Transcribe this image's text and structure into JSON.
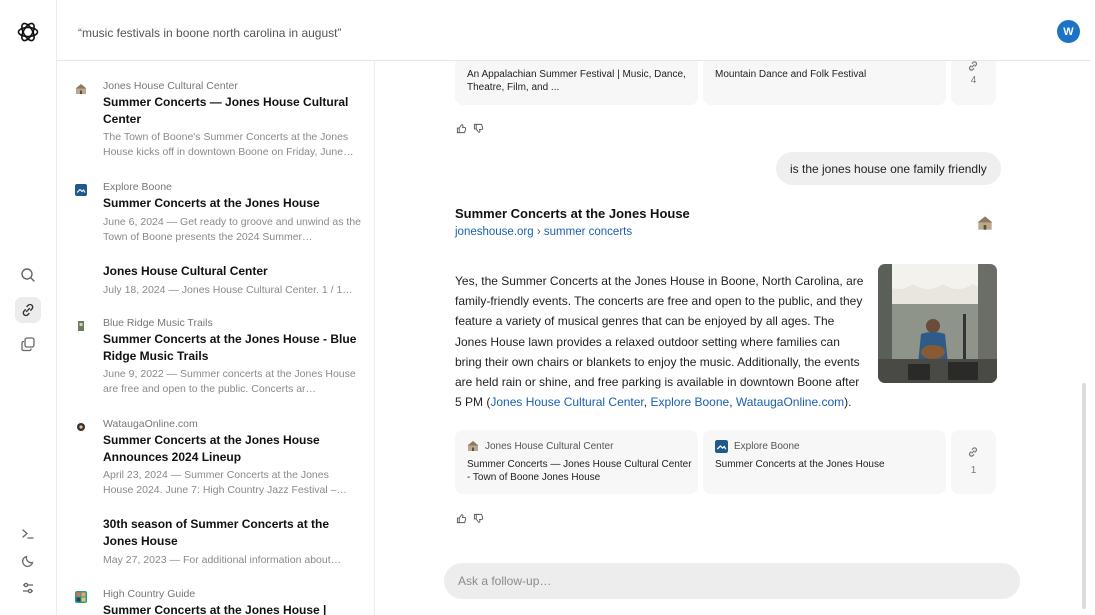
{
  "search": {
    "query": "“music festivals in boone north carolina in august”"
  },
  "user": {
    "avatar_letter": "W"
  },
  "colors": {
    "accent": "#1a73c7",
    "link": "#1a5fb4"
  },
  "rail": {
    "icons": [
      "openai-logo",
      "search-icon",
      "link-icon",
      "images-icon",
      "terminal-icon",
      "moon-icon",
      "sliders-icon"
    ]
  },
  "results": [
    {
      "source": "Jones House Cultural Center",
      "title": "Summer Concerts — Jones House Cultural Center",
      "snippet": "The Town of Boone's Summer Concerts at the Jones House kicks off in downtown Boone on Friday, June…"
    },
    {
      "source": "Explore Boone",
      "title": "Summer Concerts at the Jones House",
      "snippet": "June 6, 2024 — Get ready to groove and unwind as the Town of Boone presents the 2024 Summer…"
    },
    {
      "source": "",
      "title": "Jones House Cultural Center",
      "snippet": "July 18, 2024 — Jones House Cultural Center. 1 / 1…"
    },
    {
      "source": "Blue Ridge Music Trails",
      "title": "Summer Concerts at the Jones House - Blue Ridge Music Trails",
      "snippet": "June 9, 2022 — Summer concerts at the Jones House are free and open to the public. Concerts ar…"
    },
    {
      "source": "WataugaOnline.com",
      "title": "Summer Concerts at the Jones House Announces 2024 Lineup",
      "snippet": "April 23, 2024 — Summer Concerts at the Jones House 2024. June 7: High Country Jazz Festival –…"
    },
    {
      "source": "",
      "title": "30th season of Summer Concerts at the Jones House",
      "snippet": "May 27, 2023 — For additional information about…"
    },
    {
      "source": "High Country Guide",
      "title": "Summer Concerts at the Jones House |",
      "snippet": ""
    }
  ],
  "top_cards": [
    {
      "title": "An Appalachian Summer Festival | Music, Dance, Theatre, Film, and ..."
    },
    {
      "title": "Mountain Dance and Folk Festival"
    }
  ],
  "top_more_count": "4",
  "user_message": "is the jones house one family friendly",
  "answer": {
    "title": "Summer Concerts at the Jones House",
    "url_domain": "joneshouse.org",
    "url_sep": "›",
    "url_path": "summer concerts",
    "body": "Yes, the Summer Concerts at the Jones House in Boone, North Carolina, are family-friendly events. The concerts are free and open to the public, and they feature a variety of musical genres that can be enjoyed by all ages. The Jones House lawn provides a relaxed outdoor setting where families can bring their own chairs or blankets to enjoy the music. Additionally, the events are held rain or shine, and free parking is available in downtown Boone after 5 PM (",
    "citation_1": "Jones House Cultural Center",
    "citation_2": "Explore Boone",
    "citation_3": "WataugaOnline.com",
    "sep_1": ",",
    "sep_2": ",",
    "close": ")."
  },
  "bottom_cards": [
    {
      "source": "Jones House Cultural Center",
      "title": "Summer Concerts — Jones House Cultural Center - Town of Boone Jones House"
    },
    {
      "source": "Explore Boone",
      "title": "Summer Concerts at the Jones House"
    }
  ],
  "bottom_more_count": "1",
  "followup": {
    "placeholder": "Ask a follow-up…"
  }
}
